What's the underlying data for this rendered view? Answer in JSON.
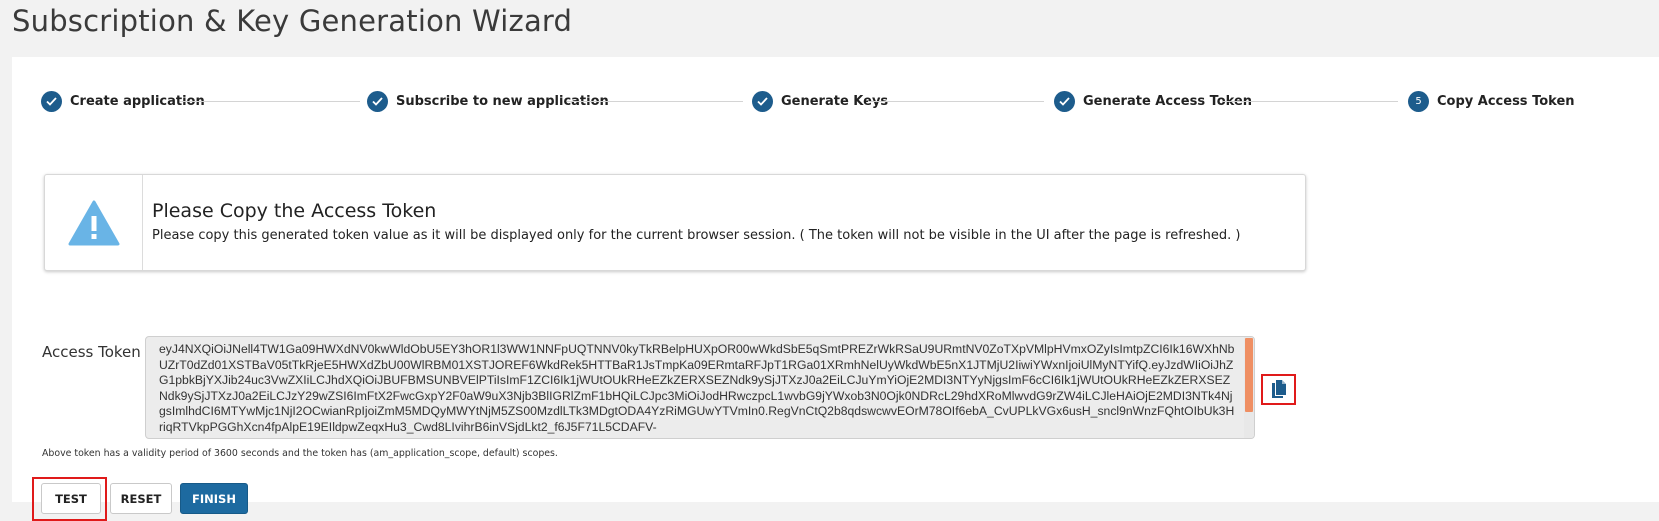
{
  "page": {
    "title": "Subscription & Key Generation Wizard"
  },
  "stepper": {
    "steps": [
      {
        "label": "Create application",
        "status": "complete"
      },
      {
        "label": "Subscribe to new application",
        "status": "complete"
      },
      {
        "label": "Generate Keys",
        "status": "complete"
      },
      {
        "label": "Generate Access Token",
        "status": "complete"
      },
      {
        "label": "Copy Access Token",
        "status": "current",
        "number": "5"
      }
    ]
  },
  "alert": {
    "icon": "warning-triangle-icon",
    "title": "Please Copy the Access Token",
    "message": "Please copy this generated token value as it will be displayed only for the current browser session. ( The token will not be visible in the UI after the page is refreshed. )"
  },
  "token": {
    "label": "Access Token",
    "value": "eyJ4NXQiOiJNell4TW1Ga09HWXdNV0kwWldObU5EY3hOR1l3WW1NNFpUQTNNV0kyTkRBelpHUXpOR00wWkdSbE5qSmtPREZrWkRSaU9URmtNV0ZoTXpVMlpHVmxOZyIsImtpZCI6Ik16WXhNbUZrT0dZd01XSTBaV05tTkRjeE5HWXdZbU00WlRBM01XSTJOREF6WkdRek5HTTBaR1JsTmpKa09ERmtaRFJpT1RGa01XRmhNelUyWkdWbE5nX1JTMjU2IiwiYWxnIjoiUlMyNTYifQ.eyJzdWIiOiJhZG1pbkBjYXJib24uc3VwZXIiLCJhdXQiOiJBUFBMSUNBVElPTiIsImF1ZCI6Ik1jWUtOUkRHeEZkZERXSEZNdk9ySjJTXzJ0a2EiLCJuYmYiOjE2MDI3NTYyNjgsImF6cCI6Ik1jWUtOUkRHeEZkZERXSEZNdk9ySjJTXzJ0a2EiLCJzY29wZSI6ImFtX2FwcGxpY2F0aW9uX3Njb3BlIGRlZmF1bHQiLCJpc3MiOiJodHRwczpcL1wvbG9jYWxob3N0Ojk0NDRcL29hdXRoMlwvdG9rZW4iLCJleHAiOjE2MDI3NTk4NjgsImlhdCI6MTYwMjc1NjI2OCwianRpIjoiZmM5MDQyMWYtNjM5ZS00MzdlLTk3MDgtODA4YzRiMGUwYTVmIn0.RegVnCtQ2b8qdswcwvEOrM78OIf6ebA_CvUPLkVGx6usH_sncl9nWnzFQhtOIbUk3HriqRTVkpPGGhXcn4fpAlpE19EIldpwZeqxHu3_Cwd8LIvihrB6inVSjdLkt2_f6J5F71L5CDAFV-",
    "copy_icon": "copy-icon",
    "validity": "Above token has a validity period of 3600 seconds and the token has (am_application_scope, default) scopes."
  },
  "buttons": {
    "test": "TEST",
    "reset": "RESET",
    "finish": "FINISH"
  },
  "colors": {
    "accent": "#1d5c8c",
    "primary_button": "#1d6aa0",
    "warning": "#69b4e6",
    "scroll_thumb": "#ef8f63",
    "highlight": "#e01a1a"
  }
}
